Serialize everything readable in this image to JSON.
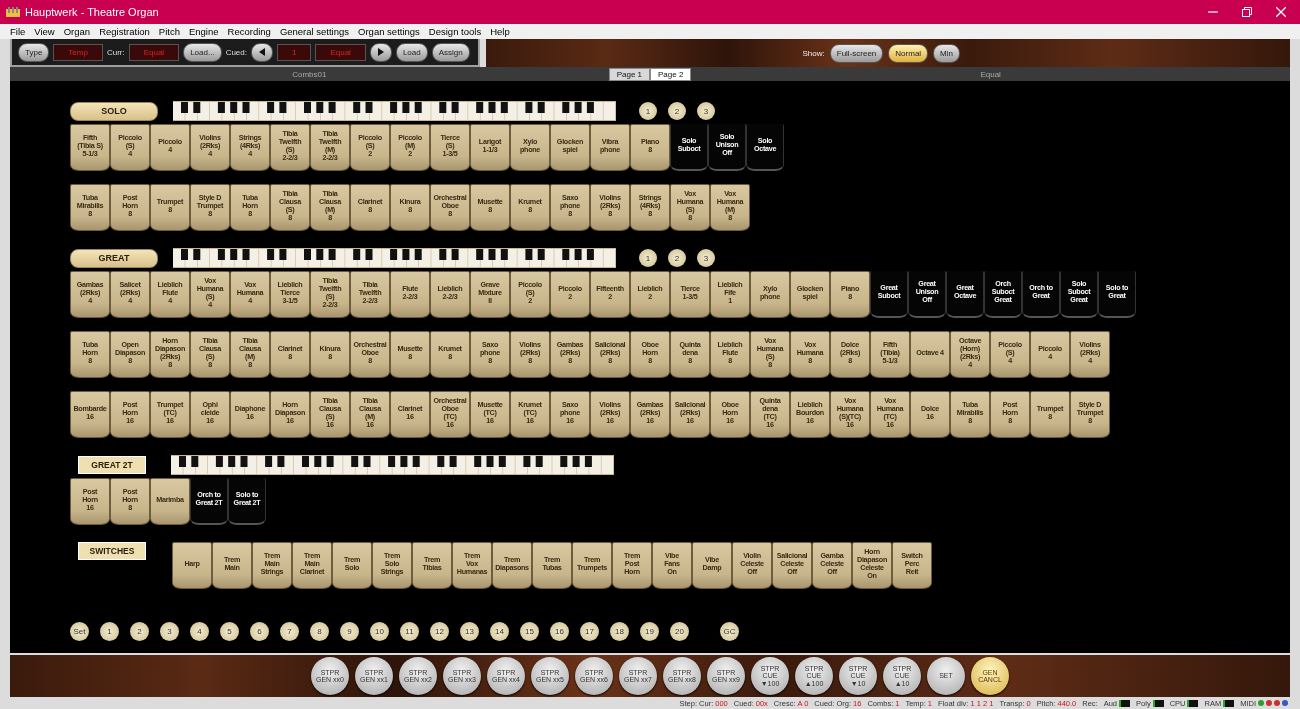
{
  "window": {
    "title": "Hauptwerk - Theatre Organ"
  },
  "menu": [
    "File",
    "View",
    "Organ",
    "Registration",
    "Pitch",
    "Engine",
    "Recording",
    "General settings",
    "Organ settings",
    "Design tools",
    "Help"
  ],
  "toolbar": {
    "left": [
      {
        "kind": "button",
        "text": "Type"
      },
      {
        "kind": "display",
        "text": "Temp"
      },
      {
        "kind": "label",
        "text": "Curr:"
      },
      {
        "kind": "display",
        "text": "Equal"
      },
      {
        "kind": "button",
        "text": "Load..."
      },
      {
        "kind": "label",
        "text": "Cued:"
      },
      {
        "kind": "prev"
      },
      {
        "kind": "display",
        "text": "1"
      },
      {
        "kind": "display",
        "text": "Equal"
      },
      {
        "kind": "next"
      },
      {
        "kind": "button",
        "text": "Load"
      },
      {
        "kind": "button",
        "text": "Assign"
      }
    ],
    "show_label": "Show:",
    "show_options": [
      {
        "text": "Full-screen",
        "selected": false
      },
      {
        "text": "Normal",
        "selected": true
      },
      {
        "text": "Min",
        "selected": false
      }
    ]
  },
  "page_bar": {
    "left": "Combs01",
    "tabs": [
      {
        "label": "Page 1",
        "selected": false
      },
      {
        "label": "Page 2",
        "selected": true
      }
    ],
    "right": "Equal"
  },
  "divisions": [
    {
      "name": "SOLO",
      "kind": "plate",
      "keyboard": true,
      "pistons": [
        "1",
        "2",
        "3"
      ],
      "rows": [
        [
          {
            "label": "Fifth\n(Tibia S)\n5-1/3",
            "kind": "stop"
          },
          {
            "label": "Piccolo\n(S)\n4",
            "kind": "stop"
          },
          {
            "label": "Piccolo\n4",
            "kind": "stop"
          },
          {
            "label": "Violins\n(2Rks)\n4",
            "kind": "stop"
          },
          {
            "label": "Strings\n(4Rks)\n4",
            "kind": "stop"
          },
          {
            "label": "Tibia\nTwelfth\n(S)\n2-2/3",
            "kind": "stop"
          },
          {
            "label": "Tibia\nTwelfth\n(M)\n2-2/3",
            "kind": "stop"
          },
          {
            "label": "Piccolo\n(S)\n2",
            "kind": "stop"
          },
          {
            "label": "Piccolo\n(M)\n2",
            "kind": "stop"
          },
          {
            "label": "Tierce\n(S)\n1-3/5",
            "kind": "stop"
          },
          {
            "label": "Larigot\n1-1/3",
            "kind": "stop"
          },
          {
            "label": "Xylo\nphone",
            "kind": "stop"
          },
          {
            "label": "Glocken\nspiel",
            "kind": "stop"
          },
          {
            "label": "Vibra\nphone",
            "kind": "stop"
          },
          {
            "label": "Piano\n8",
            "kind": "stop"
          },
          {
            "label": "Solo\nSuboct",
            "kind": "coupler"
          },
          {
            "label": "Solo\nUnison\nOff",
            "kind": "coupler"
          },
          {
            "label": "Solo\nOctave",
            "kind": "coupler"
          }
        ],
        [
          {
            "label": "Tuba\nMirabilis\n8",
            "kind": "stop"
          },
          {
            "label": "Post\nHorn\n8",
            "kind": "stop"
          },
          {
            "label": "Trumpet\n8",
            "kind": "stop"
          },
          {
            "label": "Style D\nTrumpet\n8",
            "kind": "stop"
          },
          {
            "label": "Tuba\nHorn\n8",
            "kind": "stop"
          },
          {
            "label": "Tibia\nClausa\n(S)\n8",
            "kind": "stop"
          },
          {
            "label": "Tibia\nClausa\n(M)\n8",
            "kind": "stop"
          },
          {
            "label": "Clarinet\n8",
            "kind": "stop"
          },
          {
            "label": "Kinura\n8",
            "kind": "stop"
          },
          {
            "label": "Orchestral\nOboe\n8",
            "kind": "stop"
          },
          {
            "label": "Musette\n8",
            "kind": "stop"
          },
          {
            "label": "Krumet\n8",
            "kind": "stop"
          },
          {
            "label": "Saxo\nphone\n8",
            "kind": "stop"
          },
          {
            "label": "Violins\n(2Rks)\n8",
            "kind": "stop"
          },
          {
            "label": "Strings\n(4Rks)\n8",
            "kind": "stop"
          },
          {
            "label": "Vox\nHumana\n(S)\n8",
            "kind": "stop"
          },
          {
            "label": "Vox\nHumana\n(M)\n8",
            "kind": "stop"
          }
        ]
      ]
    },
    {
      "name": "GREAT",
      "kind": "plate",
      "keyboard": true,
      "pistons": [
        "1",
        "2",
        "3"
      ],
      "rows": [
        [
          {
            "label": "Gambas\n(2Rks)\n4",
            "kind": "stop"
          },
          {
            "label": "Salicet\n(2Rks)\n4",
            "kind": "stop"
          },
          {
            "label": "Lieblich\nFlute\n4",
            "kind": "stop"
          },
          {
            "label": "Vox\nHumana\n(S)\n4",
            "kind": "stop"
          },
          {
            "label": "Vox\nHumana\n4",
            "kind": "stop"
          },
          {
            "label": "Lieblich\nTierce\n3-1/5",
            "kind": "stop"
          },
          {
            "label": "Tibia\nTwelfth\n(S)\n2-2/3",
            "kind": "stop"
          },
          {
            "label": "Tibia\nTwelfth\n2-2/3",
            "kind": "stop"
          },
          {
            "label": "Flute\n2-2/3",
            "kind": "stop"
          },
          {
            "label": "Lieblich\n2-2/3",
            "kind": "stop"
          },
          {
            "label": "Grave\nMixture\nII",
            "kind": "stop"
          },
          {
            "label": "Piccolo\n(S)\n2",
            "kind": "stop"
          },
          {
            "label": "Piccolo\n2",
            "kind": "stop"
          },
          {
            "label": "Fifteenth\n2",
            "kind": "stop"
          },
          {
            "label": "Lieblich\n2",
            "kind": "stop"
          },
          {
            "label": "Tierce\n1-3/5",
            "kind": "stop"
          },
          {
            "label": "Lieblich\nFife\n1",
            "kind": "stop"
          },
          {
            "label": "Xylo\nphone",
            "kind": "stop"
          },
          {
            "label": "Glocken\nspiel",
            "kind": "stop"
          },
          {
            "label": "Piano\n8",
            "kind": "stop"
          },
          {
            "label": "Great\nSuboct",
            "kind": "coupler"
          },
          {
            "label": "Great\nUnison\nOff",
            "kind": "coupler"
          },
          {
            "label": "Great\nOctave",
            "kind": "coupler"
          },
          {
            "label": "Orch\nSuboct\nGreat",
            "kind": "coupler"
          },
          {
            "label": "Orch to\nGreat",
            "kind": "coupler"
          },
          {
            "label": "Solo\nSuboct\nGreat",
            "kind": "coupler"
          },
          {
            "label": "Solo to\nGreat",
            "kind": "coupler"
          }
        ],
        [
          {
            "label": "Tuba\nHorn\n8",
            "kind": "stop"
          },
          {
            "label": "Open\nDiapason\n8",
            "kind": "stop"
          },
          {
            "label": "Horn\nDiapason\n(2Rks)\n8",
            "kind": "stop"
          },
          {
            "label": "Tibia\nClausa\n(S)\n8",
            "kind": "stop"
          },
          {
            "label": "Tibia\nClausa\n(M)\n8",
            "kind": "stop"
          },
          {
            "label": "Clarinet\n8",
            "kind": "stop"
          },
          {
            "label": "Kinura\n8",
            "kind": "stop"
          },
          {
            "label": "Orchestral\nOboe\n8",
            "kind": "stop"
          },
          {
            "label": "Musette\n8",
            "kind": "stop"
          },
          {
            "label": "Krumet\n8",
            "kind": "stop"
          },
          {
            "label": "Saxo\nphone\n8",
            "kind": "stop"
          },
          {
            "label": "Violins\n(2Rks)\n8",
            "kind": "stop"
          },
          {
            "label": "Gambas\n(2Rks)\n8",
            "kind": "stop"
          },
          {
            "label": "Salicional\n(2Rks)\n8",
            "kind": "stop"
          },
          {
            "label": "Oboe\nHorn\n8",
            "kind": "stop"
          },
          {
            "label": "Quinta\ndena\n8",
            "kind": "stop"
          },
          {
            "label": "Lieblich\nFlute\n8",
            "kind": "stop"
          },
          {
            "label": "Vox\nHumana\n(S)\n8",
            "kind": "stop"
          },
          {
            "label": "Vox\nHumana\n8",
            "kind": "stop"
          },
          {
            "label": "Dolce\n(2Rks)\n8",
            "kind": "stop"
          },
          {
            "label": "Fifth\n(Tibia)\n5-1/3",
            "kind": "stop"
          },
          {
            "label": "Octave 4",
            "kind": "stop"
          },
          {
            "label": "Octave\n(Horn)\n(2Rks)\n4",
            "kind": "stop"
          },
          {
            "label": "Piccolo\n(S)\n4",
            "kind": "stop"
          },
          {
            "label": "Piccolo\n4",
            "kind": "stop"
          },
          {
            "label": "Violins\n(2Rks)\n4",
            "kind": "stop"
          }
        ],
        [
          {
            "label": "Bombarde\n16",
            "kind": "stop"
          },
          {
            "label": "Post\nHorn\n16",
            "kind": "stop"
          },
          {
            "label": "Trumpet\n(TC)\n16",
            "kind": "stop"
          },
          {
            "label": "Ophi\ncleide\n16",
            "kind": "stop"
          },
          {
            "label": "Diaphone\n16",
            "kind": "stop"
          },
          {
            "label": "Horn\nDiapason\n16",
            "kind": "stop"
          },
          {
            "label": "Tibia\nClausa\n(S)\n16",
            "kind": "stop"
          },
          {
            "label": "Tibia\nClausa\n(M)\n16",
            "kind": "stop"
          },
          {
            "label": "Clarinet\n16",
            "kind": "stop"
          },
          {
            "label": "Orchestral\nOboe\n(TC)\n16",
            "kind": "stop"
          },
          {
            "label": "Musette\n(TC)\n16",
            "kind": "stop"
          },
          {
            "label": "Krumet\n(TC)\n16",
            "kind": "stop"
          },
          {
            "label": "Saxo\nphone\n16",
            "kind": "stop"
          },
          {
            "label": "Violins\n(2Rks)\n16",
            "kind": "stop"
          },
          {
            "label": "Gambas\n(2Rks)\n16",
            "kind": "stop"
          },
          {
            "label": "Salicional\n(2Rks)\n16",
            "kind": "stop"
          },
          {
            "label": "Oboe\nHorn\n16",
            "kind": "stop"
          },
          {
            "label": "Quinta\ndena\n(TC)\n16",
            "kind": "stop"
          },
          {
            "label": "Lieblich\nBourdon\n16",
            "kind": "stop"
          },
          {
            "label": "Vox\nHumana\n(S)(TC)\n16",
            "kind": "stop"
          },
          {
            "label": "Vox\nHumana\n(TC)\n16",
            "kind": "stop"
          },
          {
            "label": "Dolce\n16",
            "kind": "stop"
          },
          {
            "label": "Tuba\nMirabilis\n8",
            "kind": "stop"
          },
          {
            "label": "Post\nHorn\n8",
            "kind": "stop"
          },
          {
            "label": "Trumpet\n8",
            "kind": "stop"
          },
          {
            "label": "Style D\nTrumpet\n8",
            "kind": "stop"
          }
        ]
      ]
    },
    {
      "name": "GREAT 2T",
      "kind": "tag",
      "keyboard": true,
      "rows": [
        [
          {
            "label": "Post\nHorn\n16",
            "kind": "stop"
          },
          {
            "label": "Post\nHorn\n8",
            "kind": "stop"
          },
          {
            "label": "Marimba",
            "kind": "stop"
          },
          {
            "label": "Orch to\nGreat 2T",
            "kind": "coupler"
          },
          {
            "label": "Solo to\nGreat 2T",
            "kind": "coupler"
          }
        ]
      ]
    },
    {
      "name": "SWITCHES",
      "kind": "tag",
      "keyboard": false,
      "rows": [
        [
          {
            "label": "Harp",
            "kind": "stop"
          },
          {
            "label": "Trem\nMain",
            "kind": "stop"
          },
          {
            "label": "Trem\nMain\nStrings",
            "kind": "stop"
          },
          {
            "label": "Trem\nMain\nClarinet",
            "kind": "stop"
          },
          {
            "label": "Trem\nSolo",
            "kind": "stop"
          },
          {
            "label": "Trem\nSolo\nStrings",
            "kind": "stop"
          },
          {
            "label": "Trem\nTibias",
            "kind": "stop"
          },
          {
            "label": "Trem\nVox\nHumanas",
            "kind": "stop"
          },
          {
            "label": "Trem\nDiapasons",
            "kind": "stop"
          },
          {
            "label": "Trem\nTubas",
            "kind": "stop"
          },
          {
            "label": "Trem\nTrumpets",
            "kind": "stop"
          },
          {
            "label": "Trem\nPost\nHorn",
            "kind": "stop"
          },
          {
            "label": "Vibe\nFans\nOn",
            "kind": "stop"
          },
          {
            "label": "Vibe\nDamp",
            "kind": "stop"
          },
          {
            "label": "Violin\nCeleste\nOff",
            "kind": "stop"
          },
          {
            "label": "Salicional\nCeleste\nOff",
            "kind": "stop"
          },
          {
            "label": "Gamba\nCeleste\nOff",
            "kind": "stop"
          },
          {
            "label": "Horn\nDiapason\nCeleste\nOn",
            "kind": "stop"
          },
          {
            "label": "Switch\nPerc\nReit",
            "kind": "stop"
          }
        ]
      ]
    }
  ],
  "general_pistons": [
    "Set",
    "1",
    "2",
    "3",
    "4",
    "5",
    "6",
    "7",
    "8",
    "9",
    "10",
    "11",
    "12",
    "13",
    "14",
    "15",
    "16",
    "17",
    "18",
    "19",
    "20",
    "GC"
  ],
  "bottom_pistons": [
    {
      "label": "STPR\nGEN xx0",
      "kind": "plain"
    },
    {
      "label": "STPR\nGEN xx1",
      "kind": "plain"
    },
    {
      "label": "STPR\nGEN xx2",
      "kind": "plain"
    },
    {
      "label": "STPR\nGEN xx3",
      "kind": "plain"
    },
    {
      "label": "STPR\nGEN xx4",
      "kind": "plain"
    },
    {
      "label": "STPR\nGEN xx5",
      "kind": "plain"
    },
    {
      "label": "STPR\nGEN xx6",
      "kind": "plain"
    },
    {
      "label": "STPR\nGEN xx7",
      "kind": "plain"
    },
    {
      "label": "STPR\nGEN xx8",
      "kind": "plain"
    },
    {
      "label": "STPR\nGEN xx9",
      "kind": "plain"
    },
    {
      "label": "STPR\nCUE\n▼100",
      "kind": "plain"
    },
    {
      "label": "STPR\nCUE\n▲100",
      "kind": "plain"
    },
    {
      "label": "STPR\nCUE\n▼10",
      "kind": "plain"
    },
    {
      "label": "STPR\nCUE\n▲10",
      "kind": "plain"
    },
    {
      "label": "SET",
      "kind": "plain"
    },
    {
      "label": "GEN\nCANCL",
      "kind": "cancel"
    }
  ],
  "status_bar": {
    "items": [
      {
        "label": "Step: Cur:",
        "value": "000"
      },
      {
        "label": "Cued:",
        "value": "00x"
      },
      {
        "label": "Cresc:",
        "value": "A 0"
      },
      {
        "label": "Cued: Org:",
        "value": "16"
      },
      {
        "label": "Combs:",
        "value": "1"
      },
      {
        "label": "Temp:",
        "value": "1"
      },
      {
        "label": "Float div:",
        "value": "1 1 2 1"
      },
      {
        "label": "Transp:",
        "value": "0"
      },
      {
        "label": "Pitch:",
        "value": "440.0"
      },
      {
        "label": "Rec:"
      }
    ],
    "meters": [
      "Aud",
      "Poly",
      "CPU",
      "RAM"
    ],
    "midi": {
      "label": "MIDI",
      "lights": [
        {
          "color": "#2aa02a"
        },
        {
          "color": "#c83030"
        },
        {
          "color": "#c83030"
        },
        {
          "color": "#3458c8"
        }
      ]
    }
  }
}
